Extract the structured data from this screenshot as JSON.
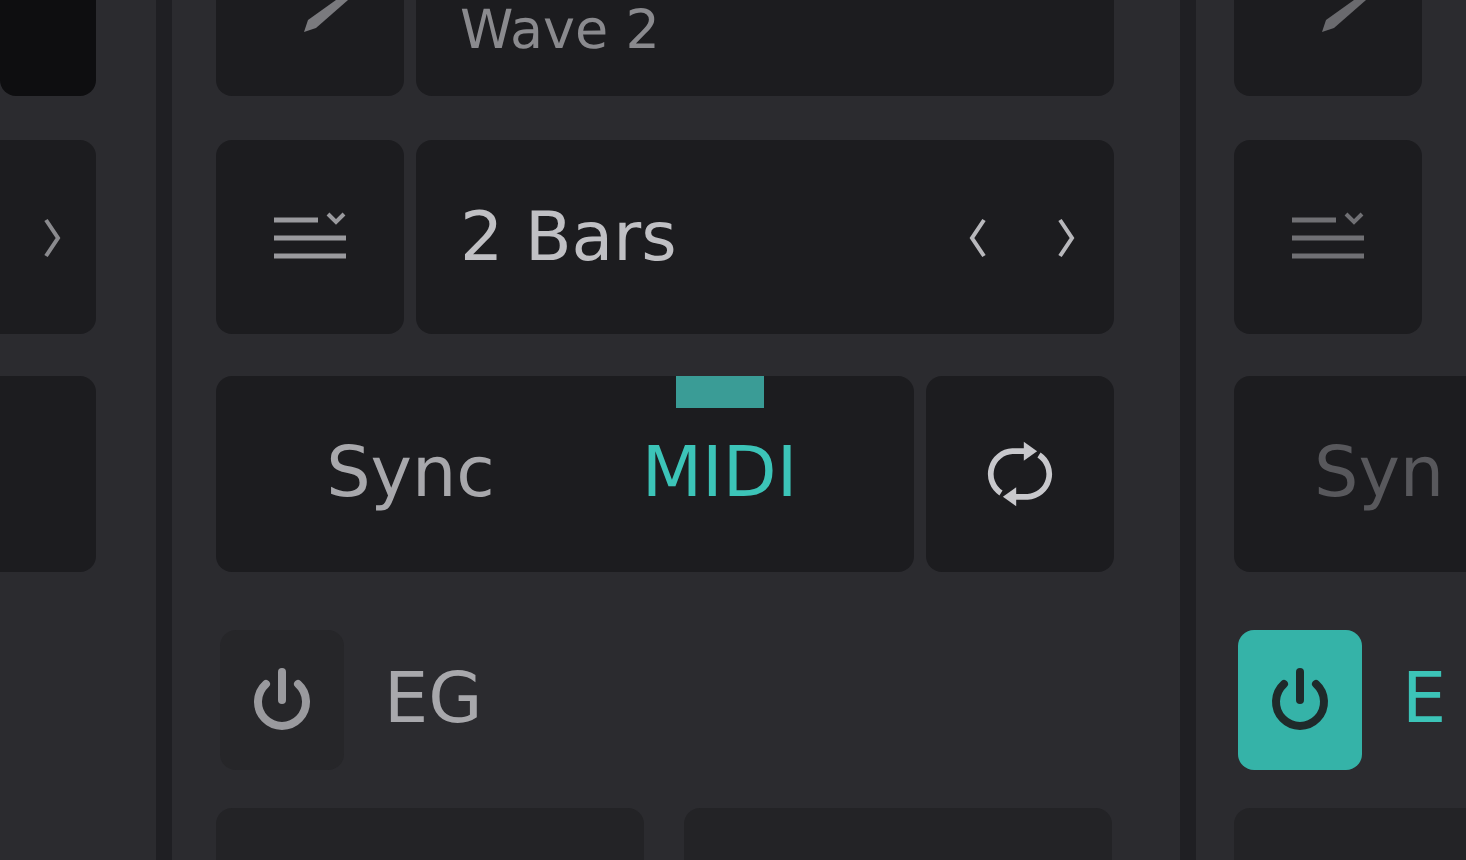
{
  "middle_column": {
    "wave": {
      "name": "Wave 2"
    },
    "length": {
      "value": "2 Bars"
    },
    "mode": {
      "disabled": false,
      "options": [
        {
          "label": "Sync",
          "selected": false
        },
        {
          "label": "MIDI",
          "selected": true
        }
      ]
    },
    "eg": {
      "label": "EG",
      "on": false
    }
  },
  "right_column": {
    "mode": {
      "disabled": true,
      "options": [
        {
          "label": "Syn",
          "selected": false
        }
      ]
    },
    "eg": {
      "label": "E",
      "on": true
    }
  }
}
